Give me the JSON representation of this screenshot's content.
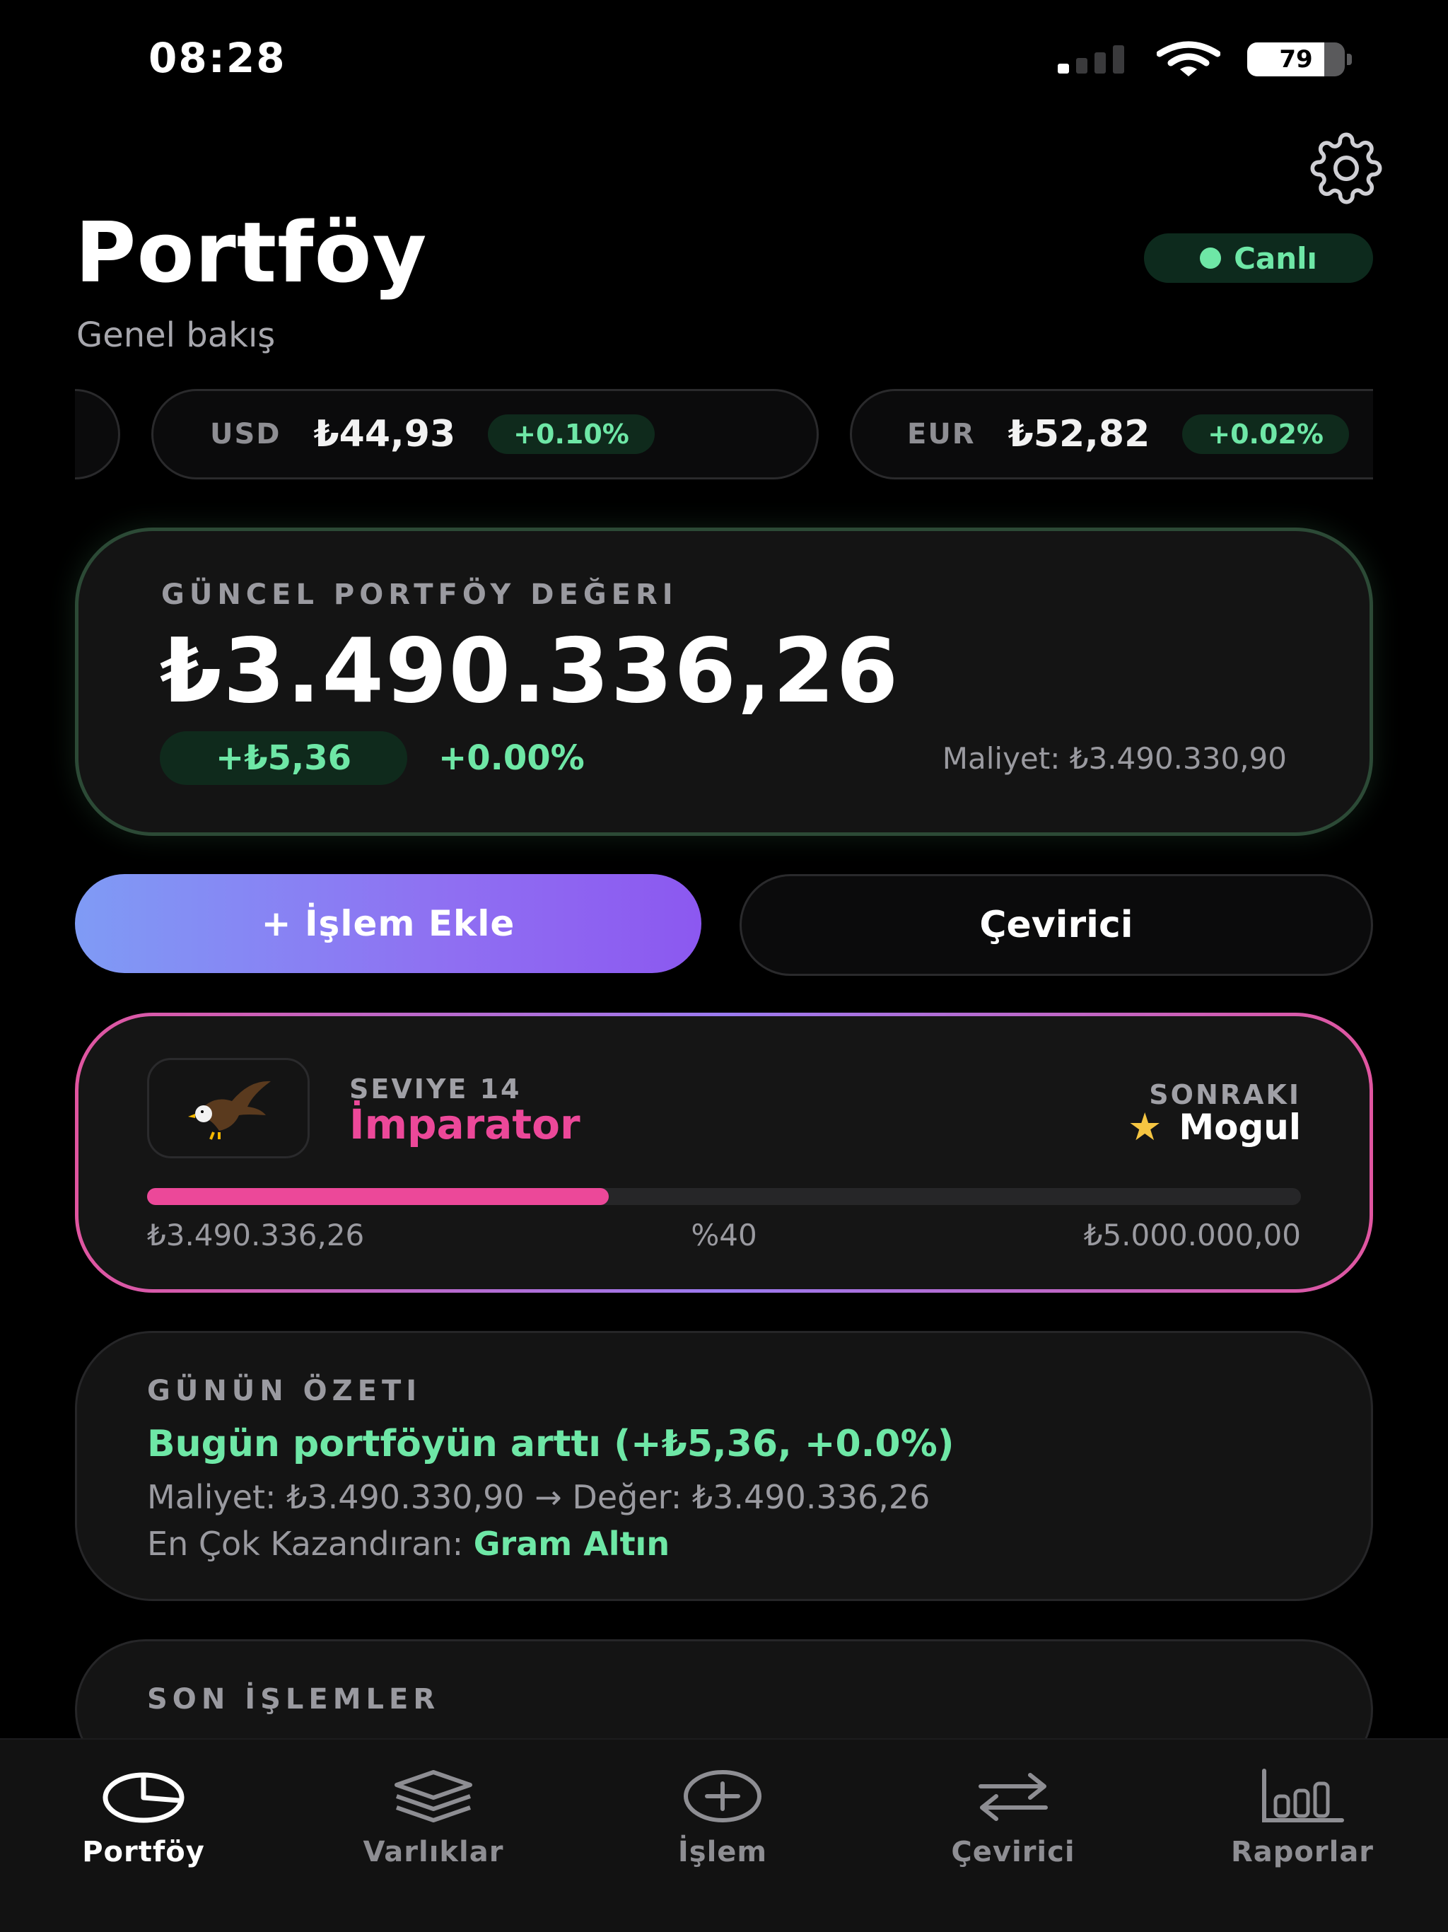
{
  "status": {
    "time": "08:28",
    "battery": "79",
    "battery_level": 0.79
  },
  "header": {
    "title": "Portföy",
    "subtitle": "Genel bakış",
    "live_label": "Canlı"
  },
  "ticker": [
    {
      "code": "USD",
      "price": "₺44,93",
      "change": "+0.10%"
    },
    {
      "code": "EUR",
      "price": "₺52,82",
      "change": "+0.02%"
    }
  ],
  "portfolio": {
    "label": "GÜNCEL PORTFÖY DEĞERI",
    "value": "₺3.490.336,26",
    "change_abs": "+₺5,36",
    "change_pct": "+0.00%",
    "cost": "Maliyet: ₺3.490.330,90"
  },
  "actions": {
    "add_label": "+ İşlem Ekle",
    "converter_label": "Çevirici"
  },
  "level": {
    "level_label": "SEVIYE 14",
    "name": "İmparator",
    "next_label": "SONRAKI",
    "next_name": "Mogul",
    "progress": 0.4,
    "current": "₺3.490.336,26",
    "percent": "%40",
    "target": "₺5.000.000,00"
  },
  "summary": {
    "label": "GÜNÜN ÖZETI",
    "headline": "Bugün portföyün arttı (+₺5,36, +0.0%)",
    "cost_line": "Maliyet: ₺3.490.330,90 → Değer: ₺3.490.336,26",
    "top_label": "En Çok Kazandıran:",
    "top_value": "Gram Altın"
  },
  "recent": {
    "label": "SON İŞLEMLER"
  },
  "nav": [
    {
      "label": "Portföy",
      "icon": "pie-chart-icon",
      "active": true
    },
    {
      "label": "Varlıklar",
      "icon": "layers-icon",
      "active": false
    },
    {
      "label": "İşlem",
      "icon": "plus-circle-icon",
      "active": false
    },
    {
      "label": "Çevirici",
      "icon": "swap-arrows-icon",
      "active": false
    },
    {
      "label": "Raporlar",
      "icon": "bar-chart-icon",
      "active": false
    }
  ],
  "colors": {
    "accent_green": "#6ee7a6",
    "level_pink": "#ec4899",
    "gradient_start": "#7f9bf5",
    "gradient_end": "#8c58f0"
  }
}
